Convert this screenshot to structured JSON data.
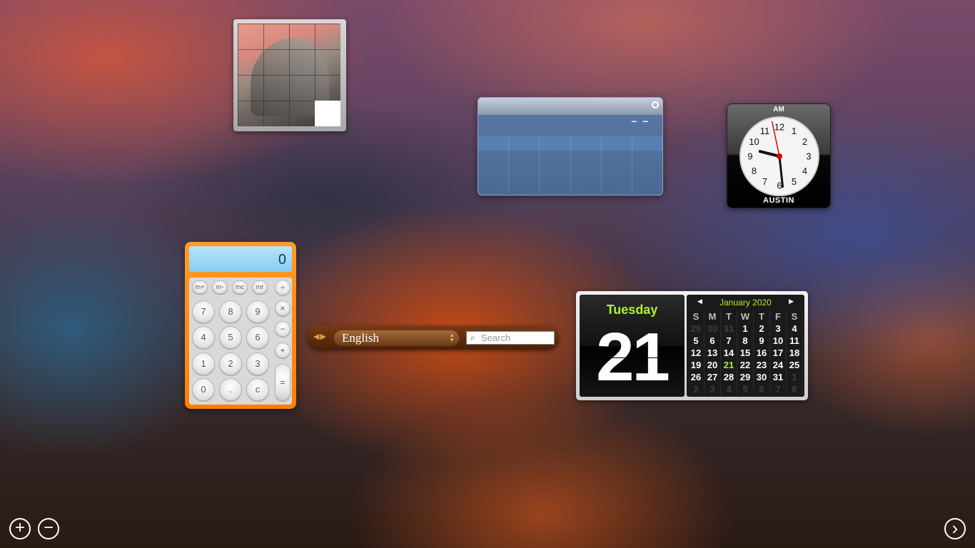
{
  "calculator": {
    "display_value": "0",
    "keys": {
      "m_plus": "m+",
      "m_minus": "m-",
      "mc": "mc",
      "mr": "mr",
      "divide": "÷",
      "multiply": "×",
      "minus": "−",
      "plus": "+",
      "equals": "=",
      "seven": "7",
      "eight": "8",
      "nine": "9",
      "four": "4",
      "five": "5",
      "six": "6",
      "one": "1",
      "two": "2",
      "three": "3",
      "zero": "0",
      "dot": ".",
      "clear": "c"
    },
    "accent_color": "#ff8a00"
  },
  "translator": {
    "arrows": "◀▶",
    "language": "English",
    "search_placeholder": "Search",
    "search_icon": "search-icon"
  },
  "clock": {
    "am_pm": "AM",
    "city": "AUSTIN",
    "numbers": [
      "12",
      "1",
      "2",
      "3",
      "4",
      "5",
      "6",
      "7",
      "8",
      "9",
      "10",
      "11"
    ],
    "time": {
      "hour": 9,
      "minute": 28,
      "second": 58
    }
  },
  "weather": {
    "placeholder": "– –",
    "info_icon": "info-icon"
  },
  "calendar": {
    "weekday": "Tuesday",
    "day": "21",
    "month_label": "January 2020",
    "prev_icon": "◀",
    "next_icon": "▶",
    "headers": [
      "S",
      "M",
      "T",
      "W",
      "T",
      "F",
      "S"
    ],
    "weeks": [
      [
        "29",
        "30",
        "31",
        "1",
        "2",
        "3",
        "4"
      ],
      [
        "5",
        "6",
        "7",
        "8",
        "9",
        "10",
        "11"
      ],
      [
        "12",
        "13",
        "14",
        "15",
        "16",
        "17",
        "18"
      ],
      [
        "19",
        "20",
        "21",
        "22",
        "23",
        "24",
        "25"
      ],
      [
        "26",
        "27",
        "28",
        "29",
        "30",
        "31",
        "1"
      ],
      [
        "2",
        "3",
        "4",
        "5",
        "6",
        "7",
        "8"
      ]
    ],
    "today_color": "#b0f02a"
  },
  "dashboard_controls": {
    "add_label": "+",
    "remove_label": "−",
    "next_label": "›"
  }
}
